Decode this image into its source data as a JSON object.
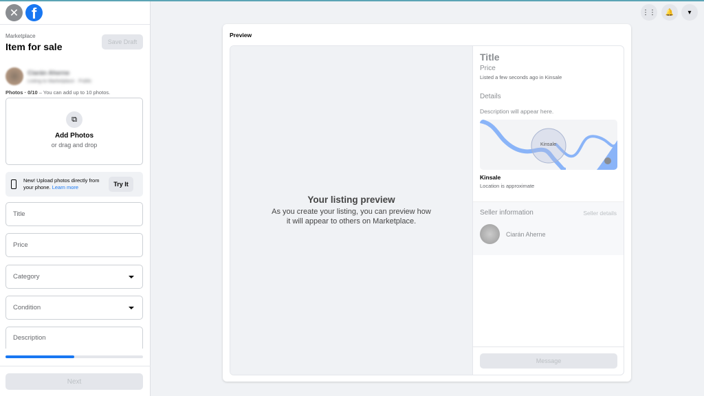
{
  "header": {
    "close_icon": "close-icon",
    "logo": "facebook-logo"
  },
  "sidebar": {
    "breadcrumb": "Marketplace",
    "title": "Item for sale",
    "save_draft": "Save Draft",
    "user": {
      "name": "Ciarán Aherne",
      "subtitle": "Listing to Marketplace · Public"
    },
    "photos_label": "Photos · 0/10",
    "photos_hint": " – You can add up to 10 photos.",
    "add_photos": "Add Photos",
    "drag_drop": "or drag and drop",
    "phone_text": "New! Upload photos directly from your phone.",
    "learn_more": "Learn more",
    "try_it": "Try It",
    "fields": [
      {
        "label": "Title"
      },
      {
        "label": "Price"
      },
      {
        "label": "Category",
        "dropdown": true
      },
      {
        "label": "Condition",
        "dropdown": true
      },
      {
        "label": "Description"
      }
    ],
    "progress_percent": 50,
    "next": "Next"
  },
  "topbar": {
    "icons": [
      "menu-grid-icon",
      "notifications-icon",
      "account-caret-icon"
    ]
  },
  "preview": {
    "heading": "Preview",
    "placeholder_title": "Your listing preview",
    "placeholder_text": "As you create your listing, you can preview how it will appear to others on Marketplace.",
    "title": "Title",
    "price": "Price",
    "listed": "Listed a few seconds ago in Kinsale",
    "details": "Details",
    "description": "Description will appear here.",
    "map_label": "Kinsale",
    "location": "Kinsale",
    "location_note": "Location is approximate",
    "seller_info": "Seller information",
    "seller_details": "Seller details",
    "seller_name": "Ciarán Aherne",
    "message": "Message",
    "colors": {
      "accent": "#1877f2",
      "water": "#8ab4f8"
    }
  }
}
